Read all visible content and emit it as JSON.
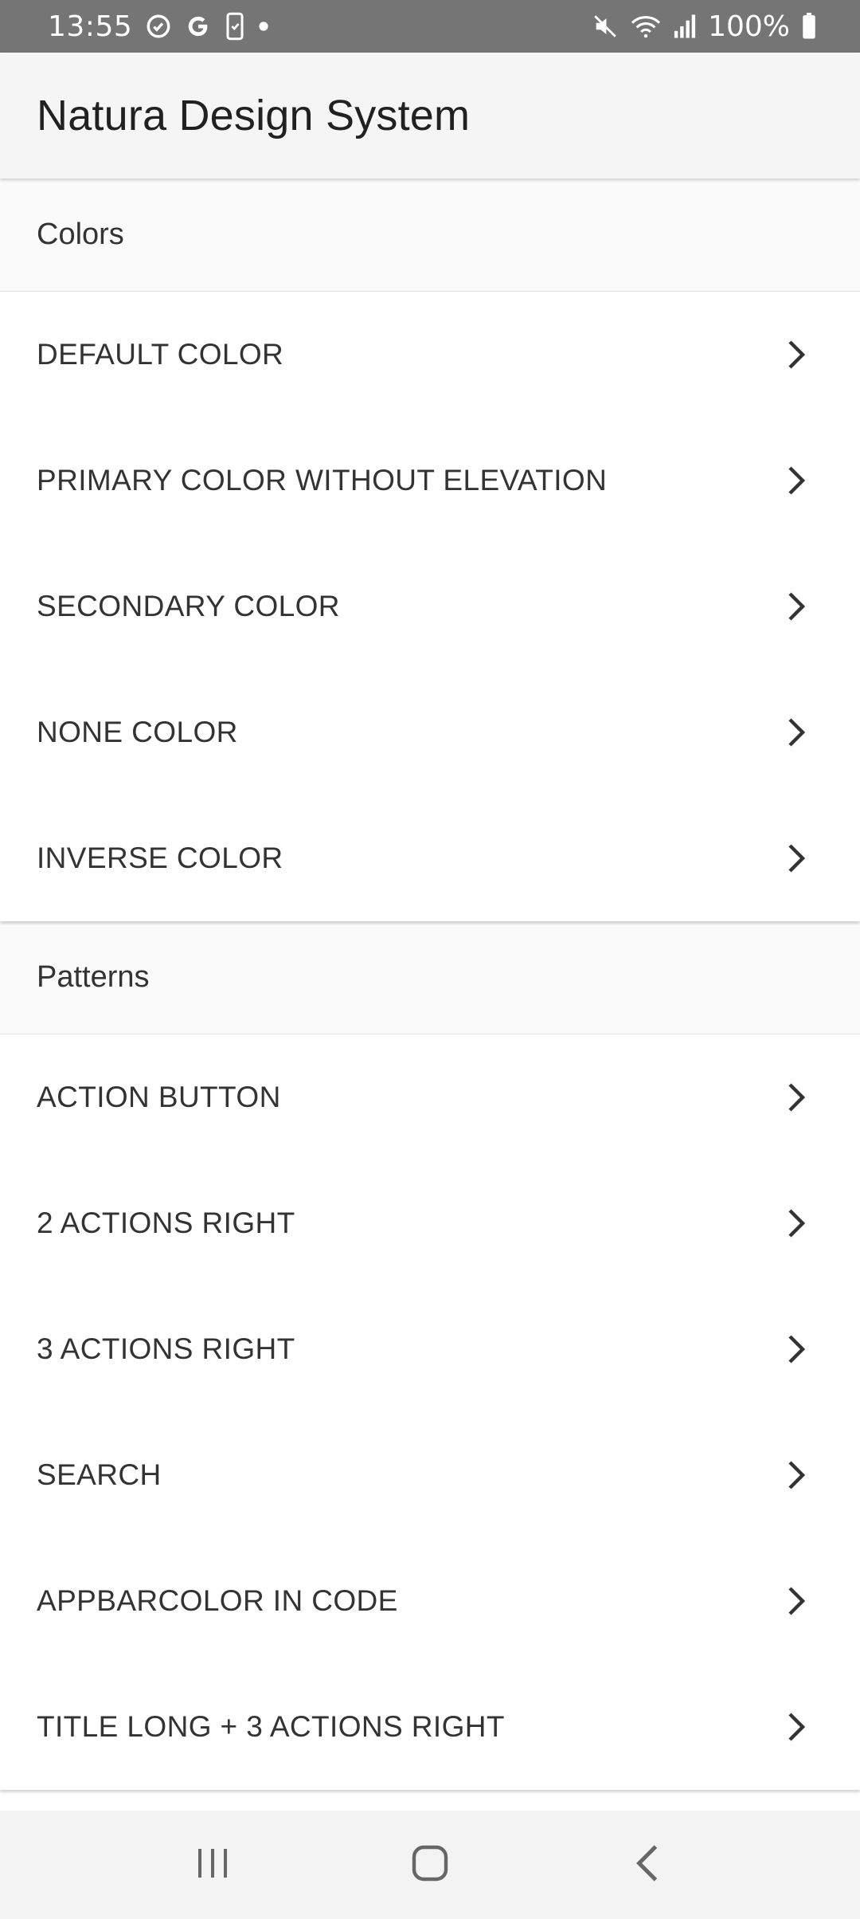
{
  "status_bar": {
    "time": "13:55",
    "battery": "100%",
    "left_icons": [
      "sync-icon",
      "google-icon",
      "device-check-icon",
      "dot-icon"
    ],
    "right_icons": [
      "mute-icon",
      "wifi-icon",
      "signal-icon",
      "battery-icon"
    ]
  },
  "app_bar": {
    "title": "Natura Design System",
    "background": "#f5f5f5"
  },
  "sections": [
    {
      "header": "Colors",
      "items": [
        {
          "label": "DEFAULT COLOR"
        },
        {
          "label": "PRIMARY COLOR WITHOUT ELEVATION"
        },
        {
          "label": "SECONDARY COLOR"
        },
        {
          "label": "NONE COLOR"
        },
        {
          "label": "INVERSE COLOR"
        }
      ]
    },
    {
      "header": "Patterns",
      "items": [
        {
          "label": "ACTION BUTTON"
        },
        {
          "label": "2 ACTIONS RIGHT"
        },
        {
          "label": "3 ACTIONS RIGHT"
        },
        {
          "label": "SEARCH"
        },
        {
          "label": "APPBARCOLOR IN CODE"
        },
        {
          "label": "TITLE LONG + 3 ACTIONS RIGHT"
        }
      ]
    }
  ],
  "nav_bar": {
    "buttons": [
      "recents-icon",
      "home-icon",
      "back-icon"
    ]
  },
  "colors": {
    "status_bar": "#757575",
    "text_primary": "#212121",
    "text_item": "#333333"
  }
}
